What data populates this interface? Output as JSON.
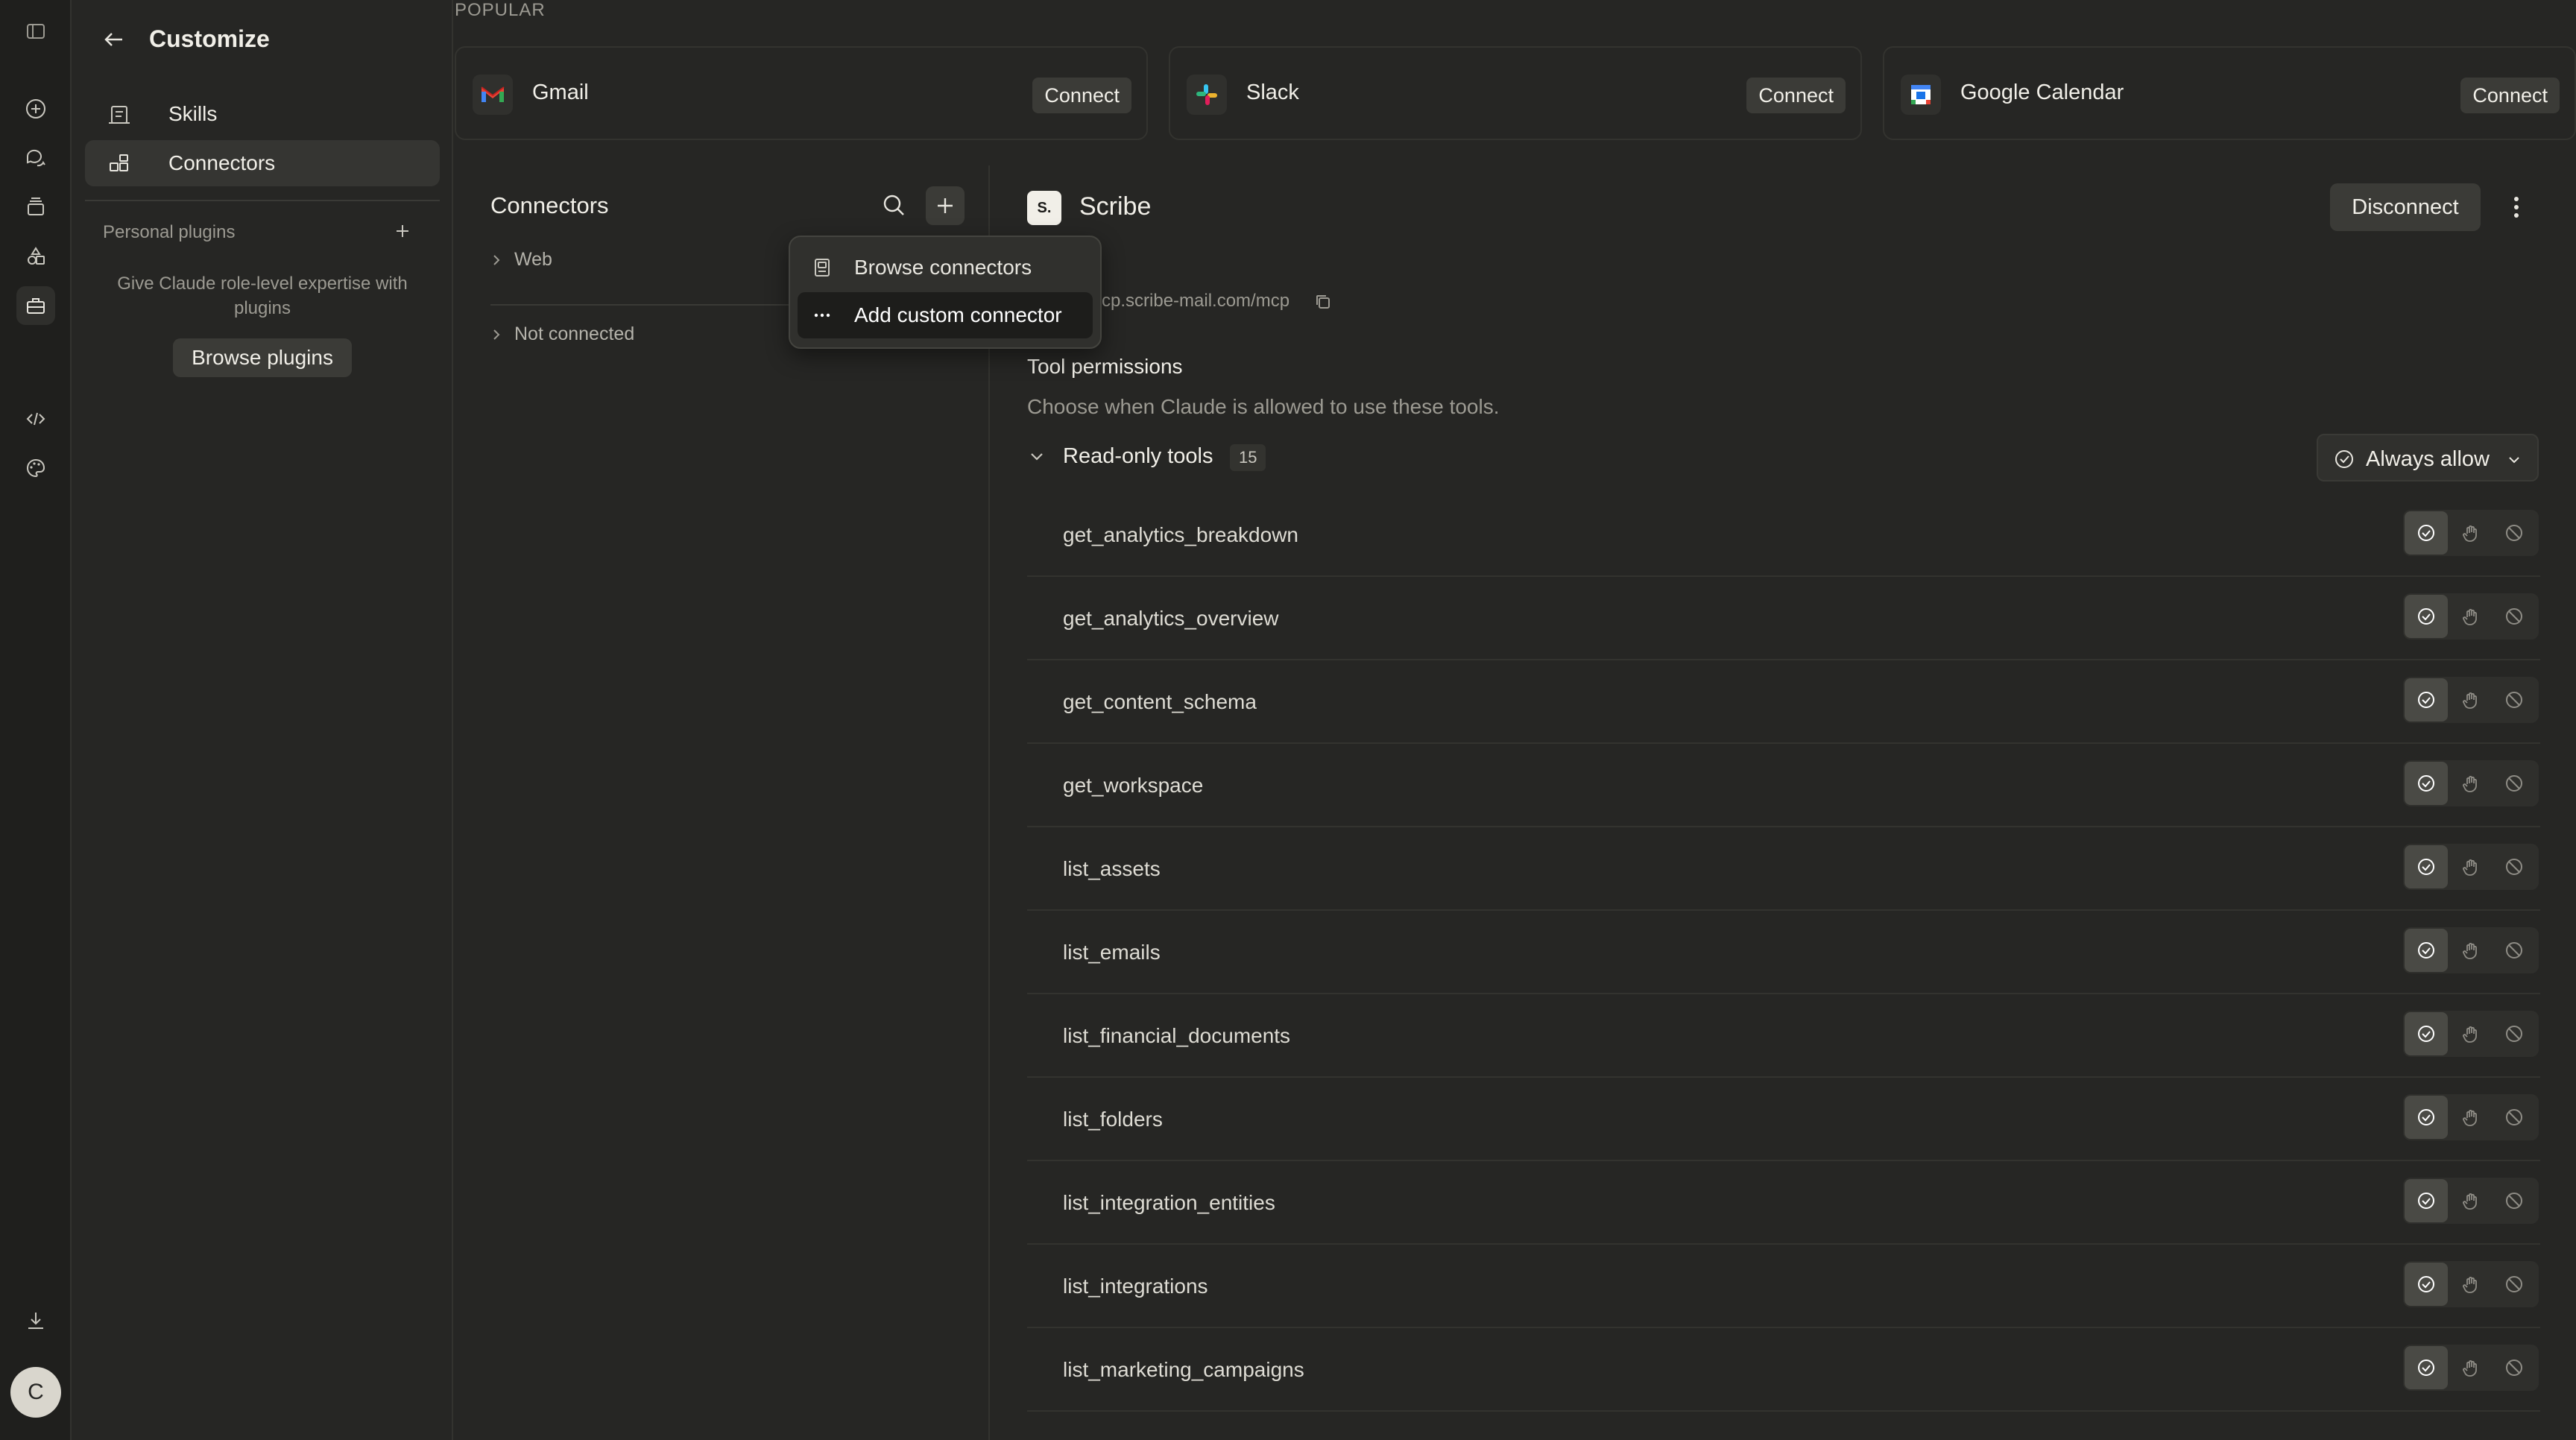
{
  "sidebar": {
    "title": "Customize",
    "nav": [
      {
        "label": "Skills"
      },
      {
        "label": "Connectors"
      }
    ],
    "personal_plugins_label": "Personal plugins",
    "plugins_description": "Give Claude role-level expertise with plugins",
    "browse_plugins_label": "Browse plugins"
  },
  "rail": {
    "avatar_initial": "C"
  },
  "popular": {
    "label": "POPULAR",
    "cards": [
      {
        "name": "Gmail",
        "action": "Connect"
      },
      {
        "name": "Slack",
        "action": "Connect"
      },
      {
        "name": "Google Calendar",
        "action": "Connect"
      }
    ]
  },
  "connectors_panel": {
    "title": "Connectors",
    "groups": [
      {
        "label": "Web"
      },
      {
        "label": "Not connected"
      }
    ]
  },
  "menu": {
    "items": [
      {
        "label": "Browse connectors"
      },
      {
        "label": "Add custom connector"
      }
    ]
  },
  "detail": {
    "logo_text": "S.",
    "name": "Scribe",
    "disconnect_label": "Disconnect",
    "url": "cp.scribe-mail.com/mcp",
    "permissions_title": "Tool permissions",
    "permissions_description": "Choose when Claude is allowed to use these tools.",
    "readonly_label": "Read-only tools",
    "readonly_count": "15",
    "always_allow_label": "Always allow",
    "tools": [
      {
        "name": "get_analytics_breakdown"
      },
      {
        "name": "get_analytics_overview"
      },
      {
        "name": "get_content_schema"
      },
      {
        "name": "get_workspace"
      },
      {
        "name": "list_assets"
      },
      {
        "name": "list_emails"
      },
      {
        "name": "list_financial_documents"
      },
      {
        "name": "list_folders"
      },
      {
        "name": "list_integration_entities"
      },
      {
        "name": "list_integrations"
      },
      {
        "name": "list_marketing_campaigns"
      }
    ]
  },
  "colors": {
    "background": "#262624",
    "rail": "#1f1f1d",
    "active_item": "#353532",
    "text_primary": "#f1efe8",
    "text_muted": "#9c9a92"
  }
}
